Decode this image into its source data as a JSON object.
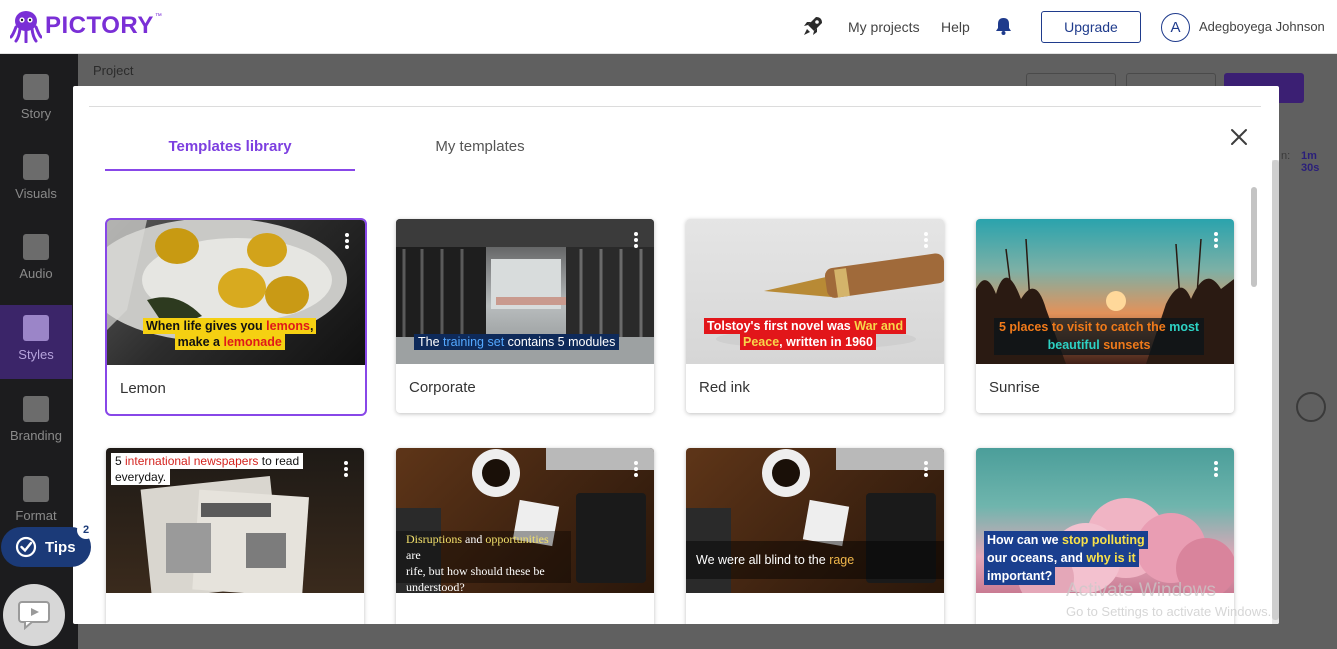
{
  "header": {
    "logo_text": "PICTORY",
    "logo_tm": "™",
    "nav": [
      "My projects",
      "Help"
    ],
    "upgrade_label": "Upgrade",
    "avatar_initial": "A",
    "user_name": "Adegboyega Johnson"
  },
  "sidebar": {
    "items": [
      {
        "label": "Story",
        "icon": "story-icon"
      },
      {
        "label": "Visuals",
        "icon": "image-icon"
      },
      {
        "label": "Audio",
        "icon": "music-icon"
      },
      {
        "label": "Styles",
        "icon": "styles-icon",
        "active": true
      },
      {
        "label": "Branding",
        "icon": "briefcase-icon"
      },
      {
        "label": "Format",
        "icon": "format-icon"
      }
    ]
  },
  "background": {
    "project_label": "Project",
    "duration_prefix": "n:",
    "duration_value": "1m 30s"
  },
  "modal": {
    "tabs": [
      {
        "label": "Templates library",
        "active": true
      },
      {
        "label": "My templates",
        "active": false
      }
    ],
    "templates": [
      {
        "name": "Lemon",
        "caption": [
          [
            "When life gives you ",
            "lemons",
            ","
          ],
          [
            "make a ",
            "lemonade",
            ""
          ]
        ]
      },
      {
        "name": "Corporate",
        "caption": [
          [
            "The ",
            "training set",
            " contains 5 modules"
          ]
        ]
      },
      {
        "name": "Red ink",
        "caption": [
          [
            "Tolstoy's first novel was ",
            "War and",
            ""
          ],
          [
            "Peace",
            ", written in 1960",
            ""
          ]
        ]
      },
      {
        "name": "Sunrise",
        "caption": [
          [
            "5 places to visit to catch the ",
            "most",
            ""
          ],
          [
            "beautiful",
            " sunsets",
            ""
          ]
        ]
      },
      {
        "name": "",
        "caption": [
          [
            "5 ",
            "international newspapers",
            " to read"
          ],
          [
            "everyday.",
            "",
            ""
          ]
        ]
      },
      {
        "name": "",
        "caption": [
          [
            "Disruptions",
            " and ",
            "opportunities",
            " are"
          ],
          [
            "rife, but how should these be"
          ],
          [
            "understood?"
          ]
        ]
      },
      {
        "name": "",
        "caption": [
          [
            "We were all blind to the ",
            "rage",
            ""
          ]
        ]
      },
      {
        "name": "",
        "caption": [
          [
            "How can we ",
            "stop polluting",
            ""
          ],
          [
            "our oceans",
            ", and ",
            "why is it"
          ],
          [
            "important?"
          ]
        ]
      }
    ]
  },
  "widgets": {
    "tips_label": "Tips",
    "tips_count": "2"
  },
  "watermark": {
    "line1": "Activate Windows",
    "line2": "Go to Settings to activate Windows."
  },
  "colors": {
    "brand": "#7a2fd6",
    "tab_active": "#8847e8",
    "navy": "#1b3a78"
  }
}
